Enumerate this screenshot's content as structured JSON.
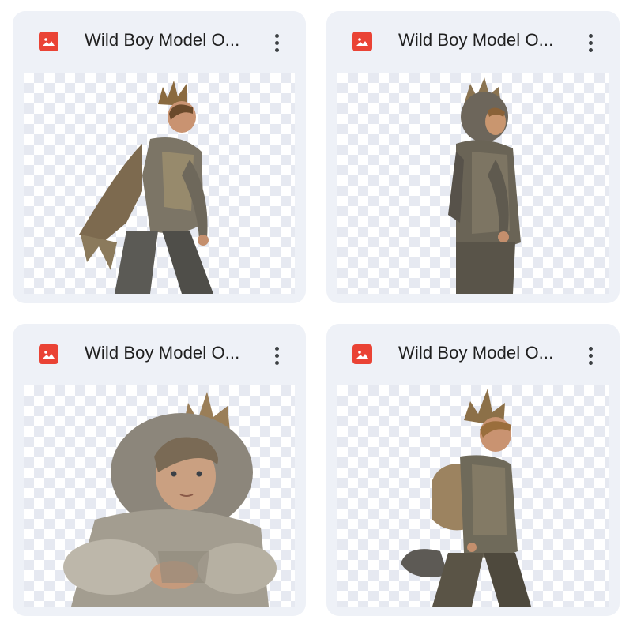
{
  "files": [
    {
      "title": "Wild Boy Model O...",
      "icon": "image-file-icon",
      "preview": "boy-walking-with-cape"
    },
    {
      "title": "Wild Boy Model O...",
      "icon": "image-file-icon",
      "preview": "boy-in-wolf-hood-side"
    },
    {
      "title": "Wild Boy Model O...",
      "icon": "image-file-icon",
      "preview": "boy-sitting-in-fur"
    },
    {
      "title": "Wild Boy Model O...",
      "icon": "image-file-icon",
      "preview": "boy-walking-with-backpack"
    }
  ],
  "colors": {
    "card_bg": "#eef1f7",
    "icon_red": "#ea4335",
    "title_text": "#1f1f1f",
    "checker": "#e6e9f1"
  }
}
